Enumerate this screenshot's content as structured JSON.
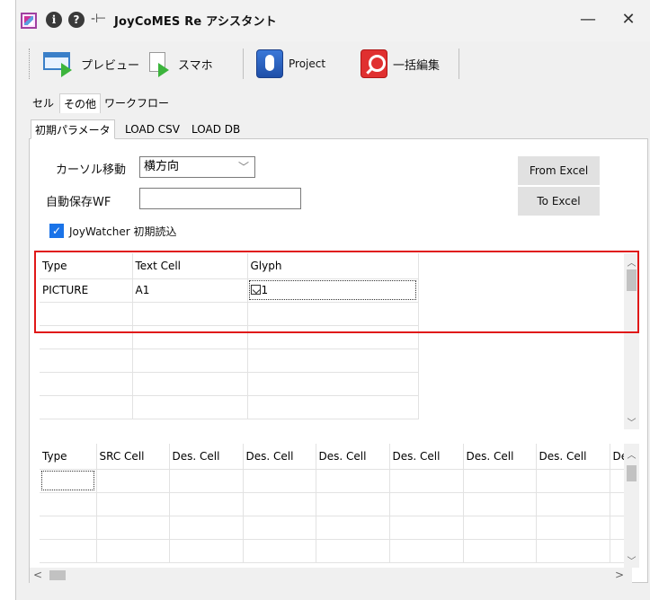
{
  "window": {
    "title": "JoyCoMES Re アシスタント",
    "minimize": "—",
    "close": "✕"
  },
  "toolbar": {
    "preview_label": "プレビュー",
    "sumaho_label": "スマホ",
    "project_label": "Project",
    "bulk_edit_label": "一括編集"
  },
  "tabs": [
    {
      "label": "セル",
      "active": false
    },
    {
      "label": "その他",
      "active": true
    },
    {
      "label": "ワークフロー",
      "active": false
    }
  ],
  "subtabs": [
    {
      "label": "初期パラメータ",
      "active": true
    },
    {
      "label": "LOAD CSV",
      "active": false
    },
    {
      "label": "LOAD DB",
      "active": false
    }
  ],
  "form": {
    "cursor_move_label": "カーソル移動",
    "cursor_move_value": "横方向",
    "autosave_label": "自動保存WF",
    "autosave_value": "",
    "joywatcher_label": "JoyWatcher 初期読込",
    "joywatcher_checked": true,
    "from_excel_label": "From Excel",
    "to_excel_label": "To Excel"
  },
  "grid1": {
    "columns": [
      "Type",
      "Text Cell",
      "Glyph"
    ],
    "rows": [
      [
        "PICTURE",
        "A1",
        "1"
      ]
    ]
  },
  "grid2": {
    "columns": [
      "Type",
      "SRC Cell",
      "Des. Cell",
      "Des. Cell",
      "Des. Cell",
      "Des. Cell",
      "Des. Cell",
      "Des. Cell",
      "De"
    ]
  },
  "colors": {
    "highlight_border": "#e01818",
    "checkbox": "#1a73e8",
    "window_bg": "#f0f0f0"
  }
}
